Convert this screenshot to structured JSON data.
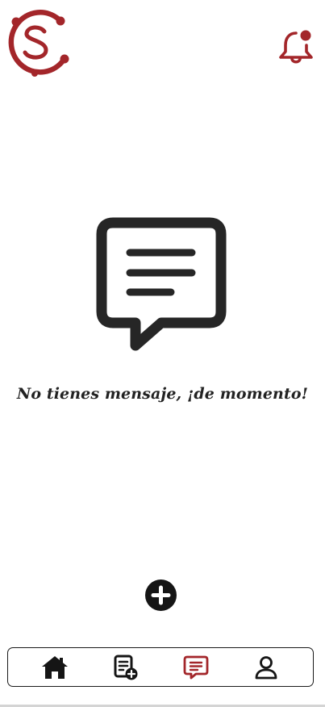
{
  "app": {
    "name": "",
    "brand_color": "#a3262a",
    "icon_color": "#151515"
  },
  "header": {
    "logo_icon": "brand-s-logo-icon",
    "notification_icon": "bell-with-dot-icon"
  },
  "empty_state": {
    "icon": "message-bubble-icon",
    "message": "No tienes mensaje, ¡de momento!"
  },
  "actions": {
    "add_icon": "plus-circle-icon"
  },
  "bottom_nav": {
    "items": [
      {
        "id": "home",
        "icon": "home-icon",
        "active": false
      },
      {
        "id": "create-post",
        "icon": "document-add-icon",
        "active": false
      },
      {
        "id": "messages",
        "icon": "chat-bubble-icon",
        "active": true
      },
      {
        "id": "profile",
        "icon": "user-icon",
        "active": false
      }
    ]
  }
}
